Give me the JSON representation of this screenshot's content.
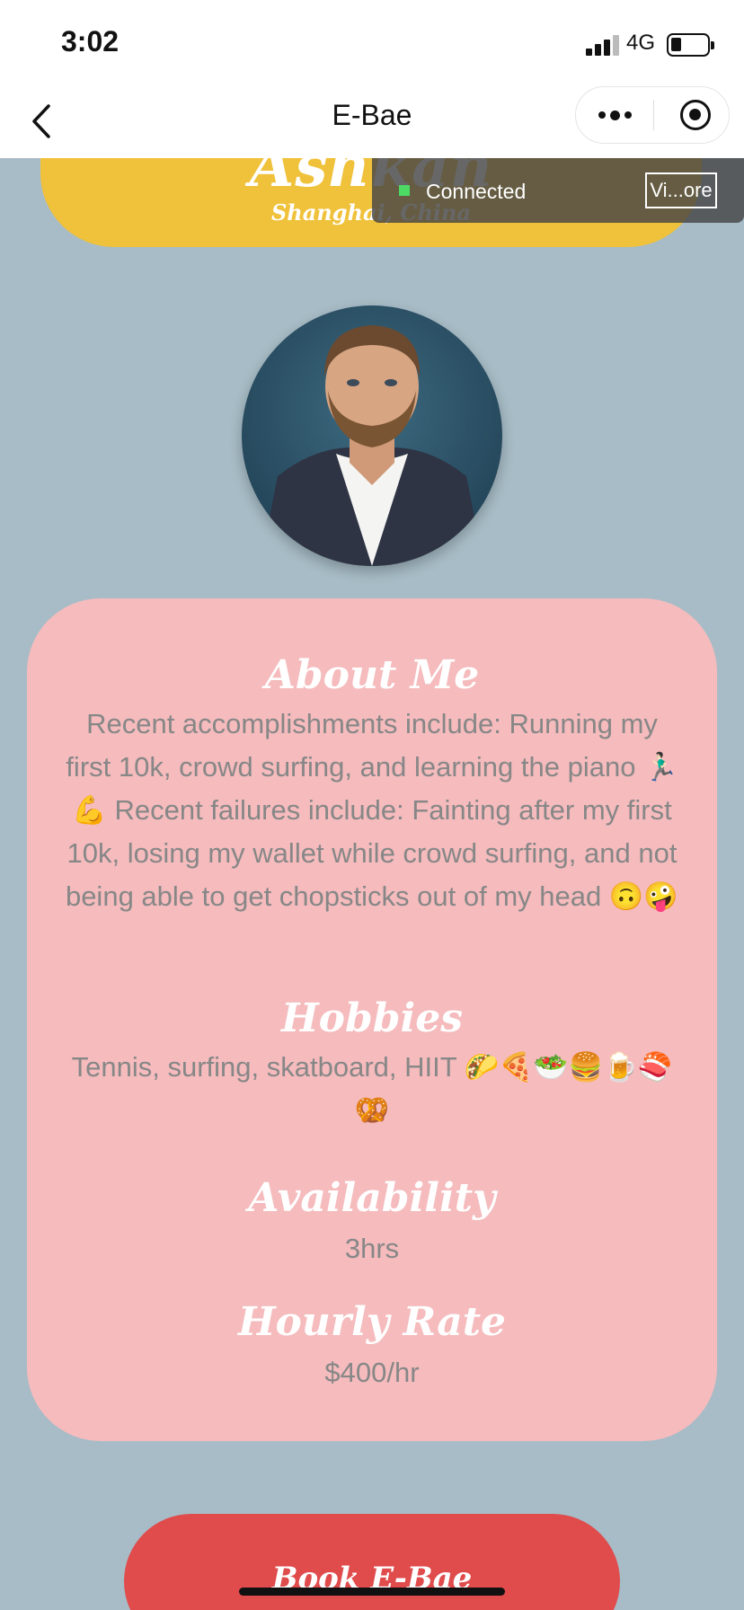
{
  "status_bar": {
    "time": "3:02",
    "network": "4G",
    "battery_level": 0.3
  },
  "nav": {
    "title": "E-Bae",
    "icons": [
      "chevron-left-icon",
      "more-icon",
      "close-mini-program-icon"
    ]
  },
  "header": {
    "name": "Ashkan",
    "location": "Shanghai, China",
    "background_color": "#f0c13a"
  },
  "connection_toast": {
    "status": "Connected",
    "button_label": "Vi...ore",
    "status_color": "#4cd964"
  },
  "profile": {
    "photo": "profile-photo"
  },
  "about": {
    "title": "About Me",
    "text": "Recent accomplishments include: Running my first 10k, crowd surfing, and learning the piano 🏃🏻‍♂️💪 Recent failures include: Fainting after my first 10k, losing my wallet while crowd surfing, and not being able to get chopsticks out of my head 🙃🤪"
  },
  "hobbies": {
    "title": "Hobbies",
    "text": "Tennis, surfing, skatboard, HIIT 🌮🍕🥗🍔🍺🍣🥨"
  },
  "availability": {
    "title": "Availability",
    "value": "3hrs"
  },
  "rate": {
    "title": "Hourly Rate",
    "value": "$400/hr"
  },
  "book_button": {
    "label": "Book E-Bae",
    "color": "#e04b4c"
  },
  "colors": {
    "page_background": "#a7bcc6",
    "card_background": "#f5bbbd",
    "body_text": "#878787"
  }
}
